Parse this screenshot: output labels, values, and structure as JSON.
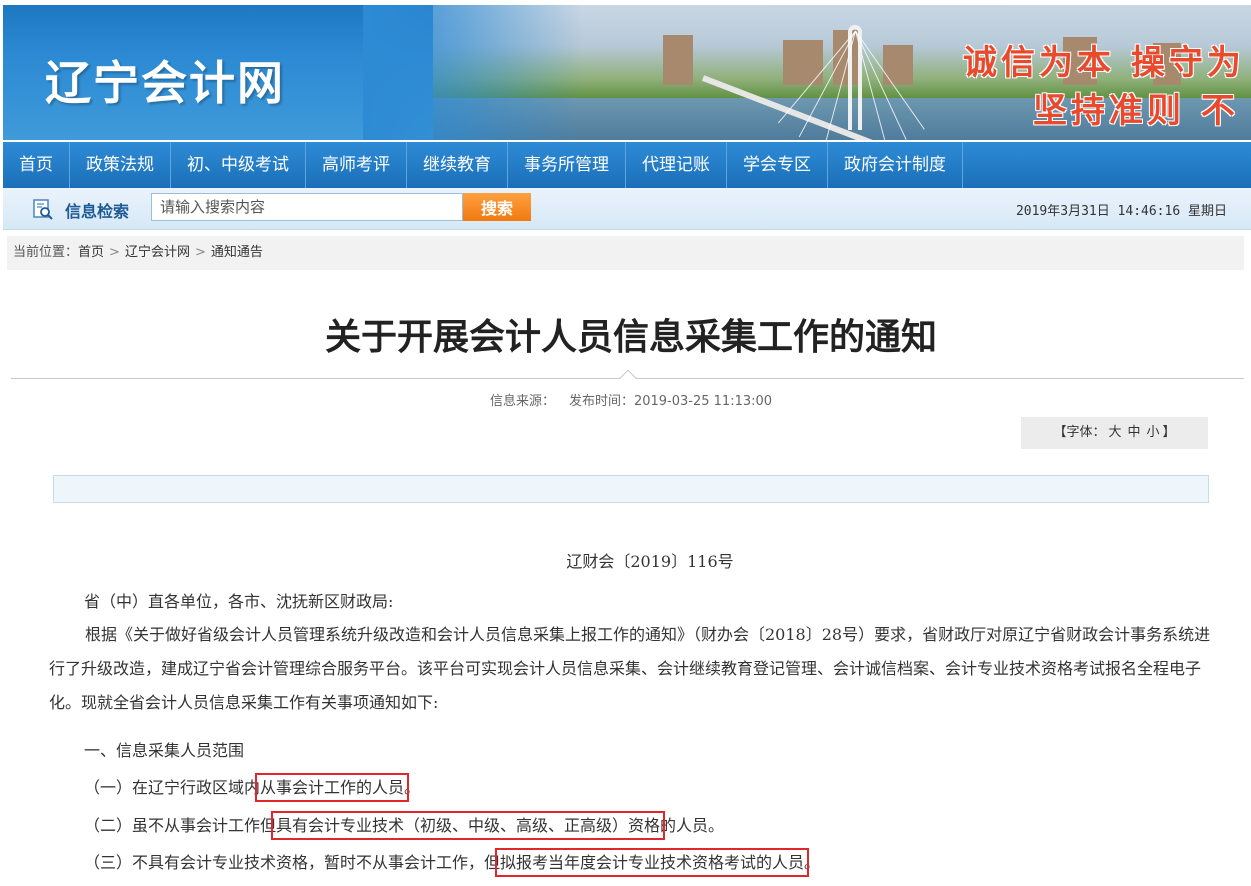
{
  "site": {
    "logo": "辽宁会计网",
    "slogan_1": "诚信为本 操守为",
    "slogan_2": "坚持准则 不"
  },
  "nav": {
    "items": [
      "首页",
      "政策法规",
      "初、中级考试",
      "高师考评",
      "继续教育",
      "事务所管理",
      "代理记账",
      "学会专区",
      "政府会计制度"
    ]
  },
  "search": {
    "label": "信息检索",
    "placeholder": "请输入搜索内容",
    "button": "搜索",
    "datetime": "2019年3月31日 14:46:16 星期日"
  },
  "breadcrumb": {
    "prefix": "当前位置：",
    "items": [
      "首页",
      "辽宁会计网",
      "通知通告"
    ],
    "separator": ">"
  },
  "article": {
    "title": "关于开展会计人员信息采集工作的通知",
    "source_label": "信息来源：",
    "publish_label": "发布时间：2019-03-25 11:13:00",
    "font_size_label": "【字体：大 中 小】",
    "font_open": "【字体：",
    "font_large": "大",
    "font_medium": "中",
    "font_small": "小",
    "font_close": "】",
    "doc_number": "辽财会〔2019〕116号",
    "salutation": "省（中）直各单位，各市、沈抚新区财政局:",
    "intro": "根据《关于做好省级会计人员管理系统升级改造和会计人员信息采集上报工作的通知》（财办会〔2018〕28号）要求，省财政厅对原辽宁省财政会计事务系统进行了升级改造，建成辽宁省会计管理综合服务平台。该平台可实现会计人员信息采集、会计继续教育登记管理、会计诚信档案、会计专业技术资格考试报名全程电子化。现就全省会计人员信息采集工作有关事项通知如下:",
    "section_1": "一、信息采集人员范围",
    "item_1_pre": "（一）在辽宁行政区域内",
    "item_1_hl": "从事会计工作的人员",
    "item_1_post": "。",
    "item_2_pre": "（二）虽不从事会计工作但",
    "item_2_hl": "具有会计专业技术（初级、中级、高级、正高级）资格",
    "item_2_post": "的人员。",
    "item_3_pre": "（三）不具有会计专业技术资格，暂时不从事会计工作，但",
    "item_3_hl": "拟报考当年度会计专业技术资格考试的人员",
    "item_3_post": "。"
  },
  "colors": {
    "nav_blue": "#1b6fb8",
    "search_orange": "#f07a10",
    "highlight_red": "#e0272c"
  }
}
